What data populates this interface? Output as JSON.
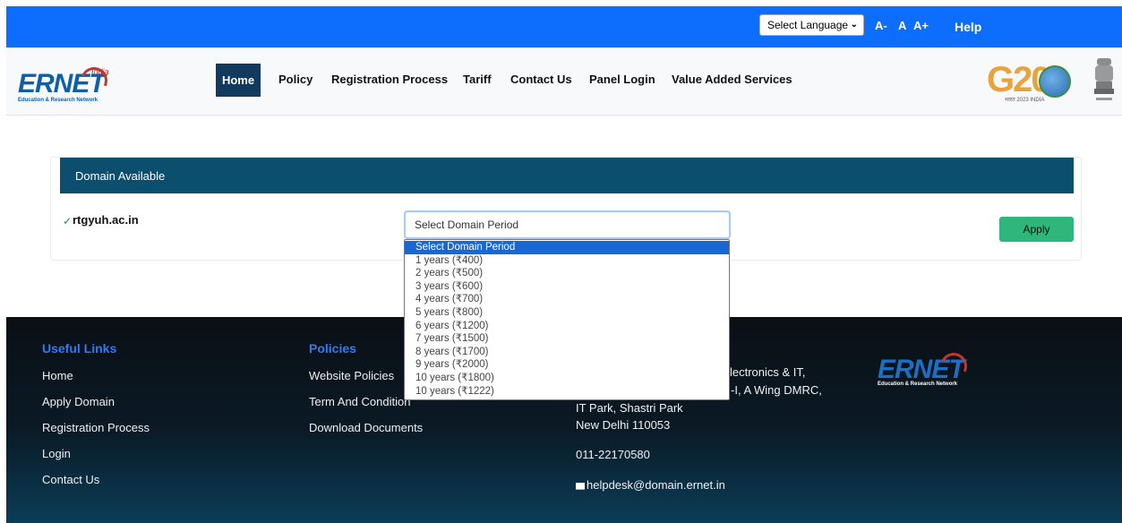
{
  "topbar": {
    "language_select": "Select Language",
    "font_smaller": "A-",
    "font_normal": "A",
    "font_larger": "A+",
    "help": "Help"
  },
  "brand": {
    "logo_text": "ERNET",
    "logo_sub": "Education & Research Network",
    "logo_india": "India",
    "g20": "G20",
    "g20_sub": "भारत 2023 INDIA"
  },
  "nav": {
    "items": [
      "Home",
      "Policy",
      "Registration Process",
      "Tariff",
      "Contact Us",
      "Panel Login",
      "Value Added Services"
    ],
    "active": "Home"
  },
  "domain_card": {
    "header": "Domain Available",
    "domain": "rtgyuh.ac.in",
    "period_select": "Select Domain Period",
    "apply": "Apply",
    "period_options": [
      "Select Domain Period",
      "1 years (₹400)",
      "2 years (₹500)",
      "3 years (₹600)",
      "4 years (₹700)",
      "5 years (₹800)",
      "6 years (₹1200)",
      "7 years (₹1500)",
      "8 years (₹1700)",
      "9 years (₹2000)",
      "10 years (₹1800)",
      "10 years (₹1222)"
    ],
    "selected_option": "Select Domain Period"
  },
  "footer": {
    "useful_links_title": "Useful Links",
    "useful_links": [
      "Home",
      "Apply Domain",
      "Registration Process",
      "Login",
      "Contact Us"
    ],
    "policies_title": "Policies",
    "policies": [
      "Website Policies",
      "Term And Condition",
      "Download Documents"
    ],
    "address_line1": "lectronics & IT,",
    "address_line2": "-I, A Wing DMRC,",
    "address_line3": "IT Park, Shastri Park",
    "address_line4": "New Delhi 110053",
    "phone": "011-22170580",
    "email": "helpdesk@domain.ernet.in"
  },
  "colors": {
    "topbar": "#0d6efd",
    "nav_active": "#123a5e",
    "card_header": "#0c4e6e",
    "apply_button": "#2fb67a",
    "footer_heading": "#2e7bf6"
  }
}
